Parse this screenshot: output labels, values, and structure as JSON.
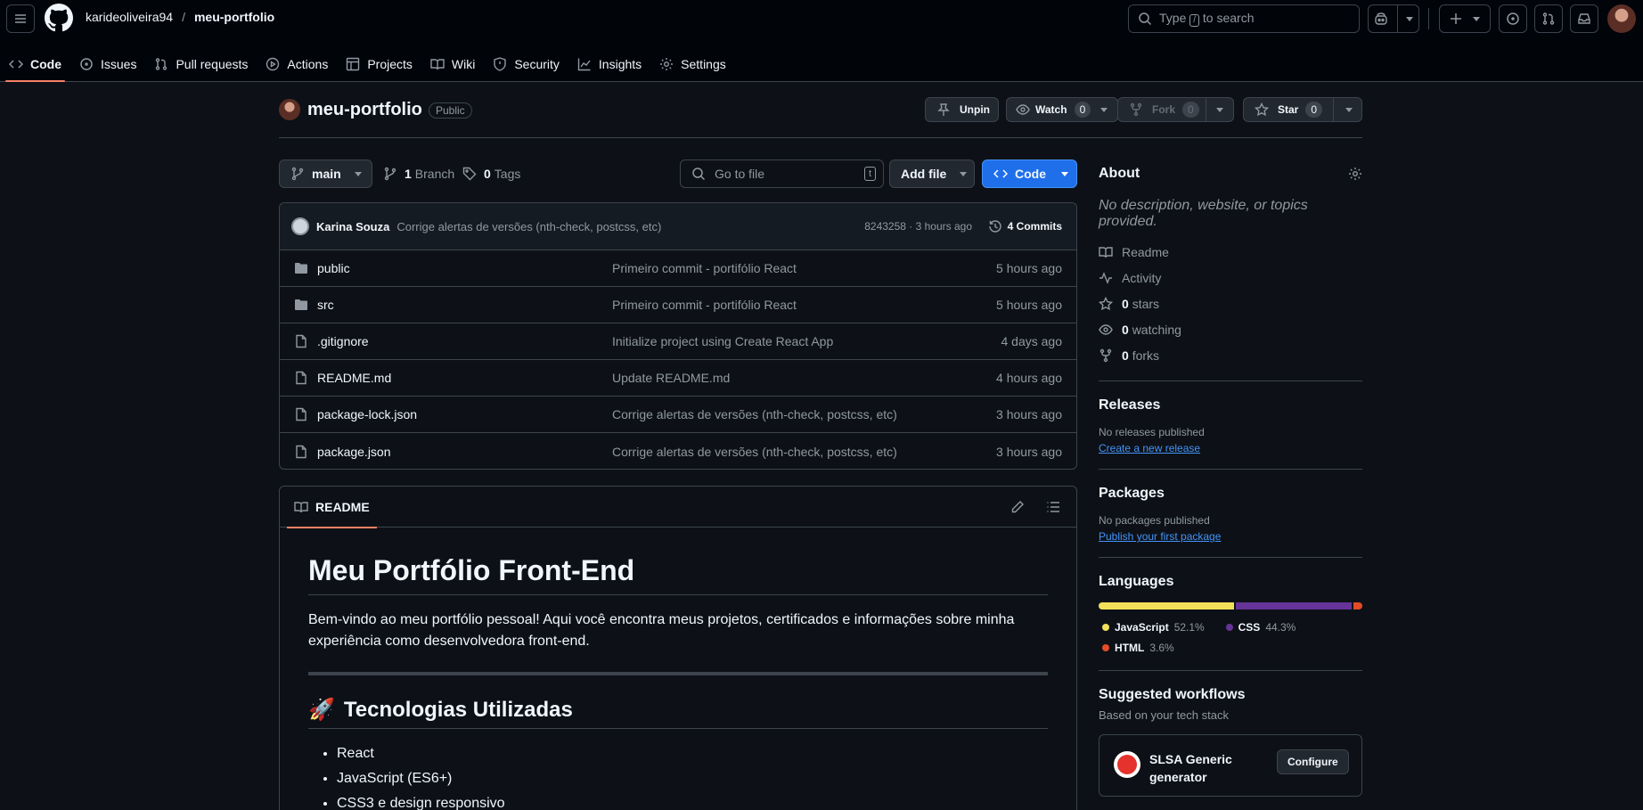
{
  "header": {
    "owner": "karideoliveira94",
    "separator": "/",
    "repo": "meu-portfolio",
    "search_prefix": "Type",
    "search_key": "/",
    "search_suffix": "to search"
  },
  "tabs": [
    {
      "label": "Code",
      "icon": "code-icon",
      "active": true
    },
    {
      "label": "Issues",
      "icon": "issue-icon"
    },
    {
      "label": "Pull requests",
      "icon": "pull-request-icon"
    },
    {
      "label": "Actions",
      "icon": "play-icon"
    },
    {
      "label": "Projects",
      "icon": "table-icon"
    },
    {
      "label": "Wiki",
      "icon": "book-icon"
    },
    {
      "label": "Security",
      "icon": "shield-icon"
    },
    {
      "label": "Insights",
      "icon": "graph-icon"
    },
    {
      "label": "Settings",
      "icon": "gear-icon"
    }
  ],
  "repo": {
    "name": "meu-portfolio",
    "visibility": "Public",
    "unpin": "Unpin",
    "watch": "Watch",
    "watch_count": "0",
    "fork": "Fork",
    "fork_count": "0",
    "star": "Star",
    "star_count": "0"
  },
  "controls": {
    "branch": "main",
    "branches_count": "1",
    "branches_label": "Branch",
    "tags_count": "0",
    "tags_label": "Tags",
    "goto_placeholder": "Go to file",
    "goto_key": "t",
    "add_file": "Add file",
    "code": "Code"
  },
  "commit": {
    "author": "Karina Souza",
    "message": "Corrige alertas de versões (nth-check, postcss, etc)",
    "hash_time": "8243258 · 3 hours ago",
    "commits": "4 Commits"
  },
  "files": [
    {
      "name": "public",
      "type": "folder",
      "message": "Primeiro commit - portifólio React",
      "time": "5 hours ago"
    },
    {
      "name": "src",
      "type": "folder",
      "message": "Primeiro commit - portifólio React",
      "time": "5 hours ago"
    },
    {
      "name": ".gitignore",
      "type": "file",
      "message": "Initialize project using Create React App",
      "time": "4 days ago"
    },
    {
      "name": "README.md",
      "type": "file",
      "message": "Update README.md",
      "time": "4 hours ago"
    },
    {
      "name": "package-lock.json",
      "type": "file",
      "message": "Corrige alertas de versões (nth-check, postcss, etc)",
      "time": "3 hours ago"
    },
    {
      "name": "package.json",
      "type": "file",
      "message": "Corrige alertas de versões (nth-check, postcss, etc)",
      "time": "3 hours ago"
    }
  ],
  "readme": {
    "tab": "README",
    "h1": "Meu Portfólio Front-End",
    "intro": "Bem-vindo ao meu portfólio pessoal! Aqui você encontra meus projetos, certificados e informações sobre minha experiência como desenvolvedora front-end.",
    "h2_emoji": "🚀",
    "h2": "Tecnologias Utilizadas",
    "list": [
      "React",
      "JavaScript (ES6+)",
      "CSS3 e design responsivo"
    ]
  },
  "about": {
    "title": "About",
    "description": "No description, website, or topics provided.",
    "items": [
      {
        "icon": "book-icon",
        "label": "Readme"
      },
      {
        "icon": "pulse-icon",
        "label": "Activity"
      },
      {
        "icon": "star-icon",
        "count": "0",
        "label": "stars"
      },
      {
        "icon": "eye-icon",
        "count": "0",
        "label": "watching"
      },
      {
        "icon": "fork-icon",
        "count": "0",
        "label": "forks"
      }
    ]
  },
  "releases": {
    "title": "Releases",
    "empty": "No releases published",
    "link": "Create a new release"
  },
  "packages": {
    "title": "Packages",
    "empty": "No packages published",
    "link": "Publish your first package"
  },
  "languages": {
    "title": "Languages",
    "items": [
      {
        "name": "JavaScript",
        "pct": "52.1%",
        "value": 52.1,
        "color": "#f1e05a"
      },
      {
        "name": "CSS",
        "pct": "44.3%",
        "value": 44.3,
        "color": "#663399"
      },
      {
        "name": "HTML",
        "pct": "3.6%",
        "value": 3.6,
        "color": "#e34c26"
      }
    ]
  },
  "workflows": {
    "title": "Suggested workflows",
    "subtitle": "Based on your tech stack",
    "item_name_line1": "SLSA Generic",
    "item_name_line2": "generator",
    "configure": "Configure"
  }
}
